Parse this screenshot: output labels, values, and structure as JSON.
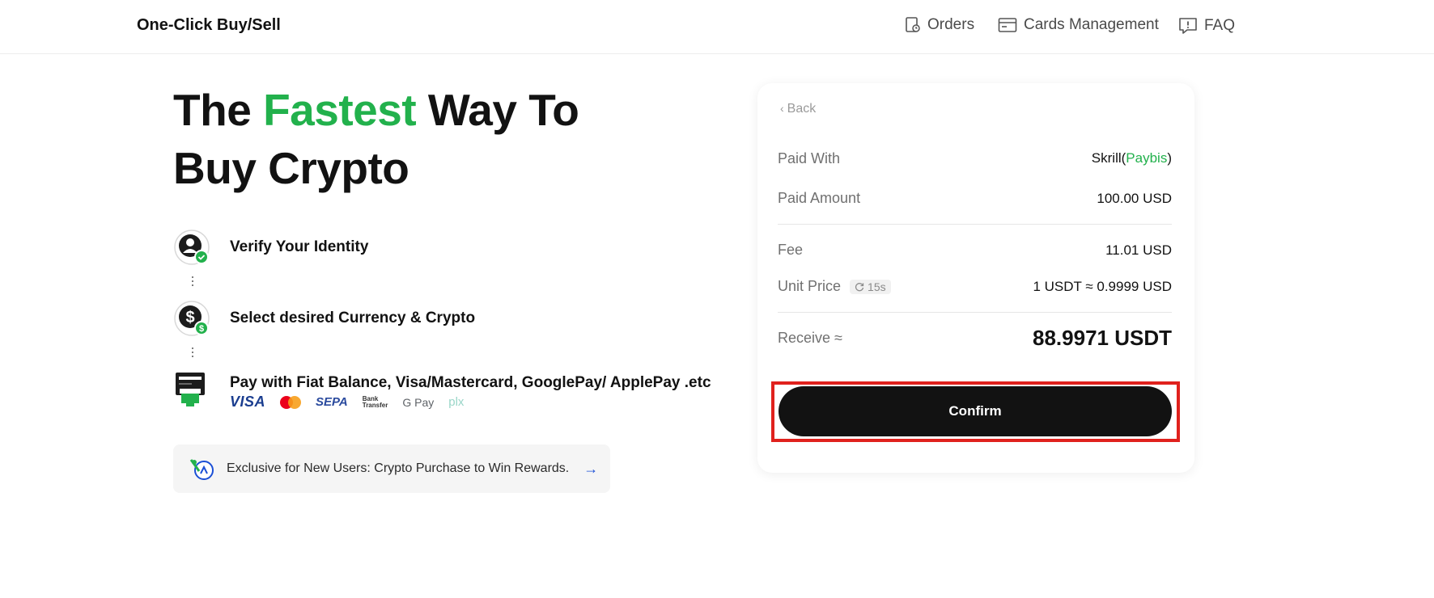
{
  "header": {
    "brand": "One-Click Buy/Sell",
    "nav": {
      "orders": "Orders",
      "cards": "Cards Management",
      "faq": "FAQ"
    }
  },
  "hero": {
    "line1_part1": "The ",
    "line1_highlight": "Fastest",
    "line1_part2": " Way To",
    "line2": "Buy Crypto"
  },
  "steps": [
    {
      "label": "Verify Your Identity",
      "icon": "user-verified-icon"
    },
    {
      "label": "Select desired Currency & Crypto",
      "icon": "dollar-coin-icon"
    },
    {
      "label": "Pay with Fiat Balance, Visa/Mastercard, GooglePay/ ApplePay .etc",
      "icon": "card-terminal-icon"
    }
  ],
  "payment_logos": {
    "visa": "VISA",
    "sepa": "SEPA",
    "bank_line1": "Bank",
    "bank_line2": "Transfer",
    "gpay": "G Pay",
    "plx": "plx"
  },
  "promo": {
    "text": "Exclusive for New Users: Crypto Purchase to Win Rewards.",
    "arrow": "→"
  },
  "order": {
    "back": "Back",
    "paid_with_label": "Paid With",
    "paid_with_value": "Skrill(",
    "paid_with_provider": "Paybis",
    "paid_with_close": ")",
    "paid_amount_label": "Paid Amount",
    "paid_amount_value": "100.00",
    "paid_amount_currency": " USD",
    "fee_label": "Fee",
    "fee_value": "11.01 USD",
    "unit_price_label": "Unit Price",
    "unit_price_timer": "15s",
    "unit_price_value": "1 USDT ≈ 0.9999 USD",
    "receive_label": "Receive ≈",
    "receive_value": "88.9971 USDT",
    "confirm": "Confirm"
  },
  "colors": {
    "accent_green": "#22b14c",
    "button_black": "#121212",
    "highlight_red": "#e0211d"
  }
}
